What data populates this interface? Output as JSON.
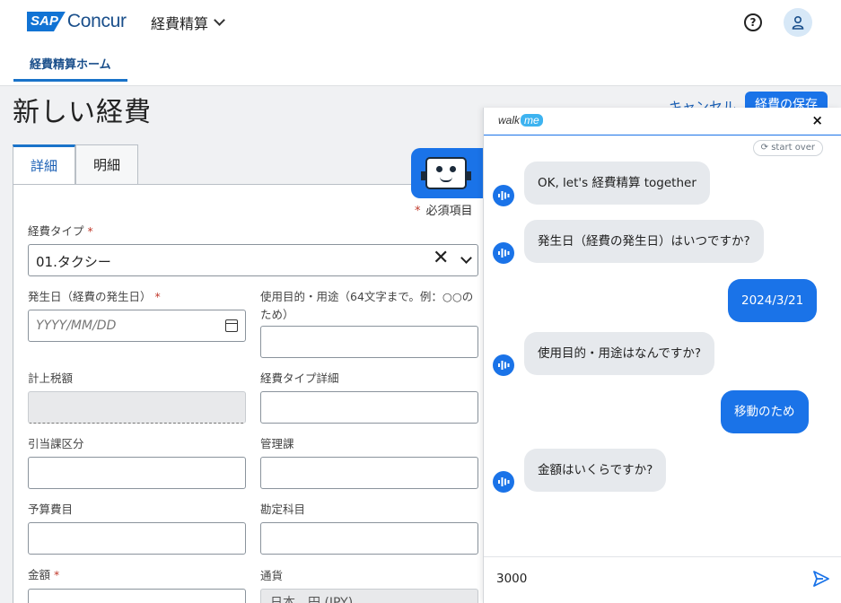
{
  "header": {
    "brand_sap": "SAP",
    "brand_name": "Concur",
    "app_name": "経費精算",
    "help_glyph": "?",
    "nav_tab": "経費精算ホーム"
  },
  "page": {
    "title": "新しい経費",
    "cancel_label": "キャンセル",
    "save_label": "経費の保存",
    "tabs": [
      {
        "label": "詳細",
        "active": true
      },
      {
        "label": "明細",
        "active": false
      }
    ],
    "required_note": "必須項目"
  },
  "form": {
    "expense_type": {
      "label": "経費タイプ",
      "required": true,
      "value": "01.タクシー"
    },
    "date": {
      "label": "発生日（経費の発生日）",
      "required": true,
      "placeholder": "YYYY/MM/DD"
    },
    "purpose": {
      "label": "使用目的・用途（64文字まで。例：○○のため）",
      "value": ""
    },
    "taxed_amount": {
      "label": "計上税額",
      "value": ""
    },
    "type_detail": {
      "label": "経費タイプ詳細",
      "value": ""
    },
    "division": {
      "label": "引当課区分",
      "value": ""
    },
    "management": {
      "label": "管理課",
      "value": ""
    },
    "budget": {
      "label": "予算費目",
      "value": ""
    },
    "account": {
      "label": "勘定科目",
      "value": ""
    },
    "amount": {
      "label": "金額",
      "required": true,
      "value": ""
    },
    "currency": {
      "label": "通貨",
      "value": "日本、円 (JPY)"
    }
  },
  "chat": {
    "logo_walk": "walk",
    "logo_me": "me",
    "close_glyph": "×",
    "start_over": "start over",
    "messages": [
      {
        "from": "bot",
        "text": "OK, let's 経費精算 together"
      },
      {
        "from": "bot",
        "text": "発生日（経費の発生日）はいつですか?"
      },
      {
        "from": "user",
        "text": "2024/3/21"
      },
      {
        "from": "bot",
        "text": "使用目的・用途はなんですか?"
      },
      {
        "from": "user",
        "text": "移動のため"
      },
      {
        "from": "bot",
        "text": "金額はいくらですか?"
      }
    ],
    "input_value": "3000"
  },
  "colors": {
    "primary": "#1a73e8",
    "brand_dark": "#1a4f8b",
    "required": "#c0392b",
    "bot_bubble": "#e6e9ed"
  },
  "icons": [
    "help-icon",
    "user-icon",
    "chevron-down-icon",
    "clear-icon",
    "calendar-icon",
    "bot-icon",
    "close-icon",
    "refresh-icon",
    "send-icon",
    "waveform-icon"
  ]
}
